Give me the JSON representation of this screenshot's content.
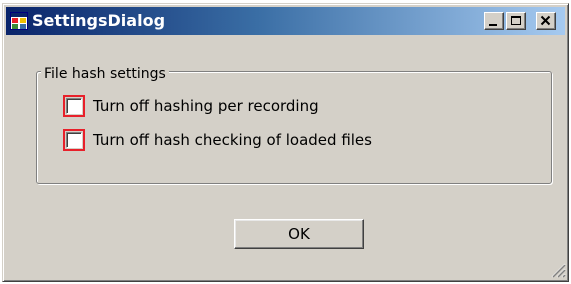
{
  "window": {
    "title": "SettingsDialog",
    "icon": "app-window-icon",
    "caption_buttons": [
      "minimize-icon",
      "maximize-icon",
      "close-icon"
    ]
  },
  "group": {
    "label": "File hash settings"
  },
  "options": [
    {
      "label": "Turn off hashing per recording",
      "checked": false
    },
    {
      "label": "Turn off hash checking of loaded files",
      "checked": false
    }
  ],
  "ok_button": {
    "label": "OK"
  },
  "colors": {
    "dialog_face": "#d4d0c8",
    "title_gradient_start": "#0a246a",
    "title_gradient_end": "#a6caf0",
    "highlight_outline": "#e8202a"
  }
}
